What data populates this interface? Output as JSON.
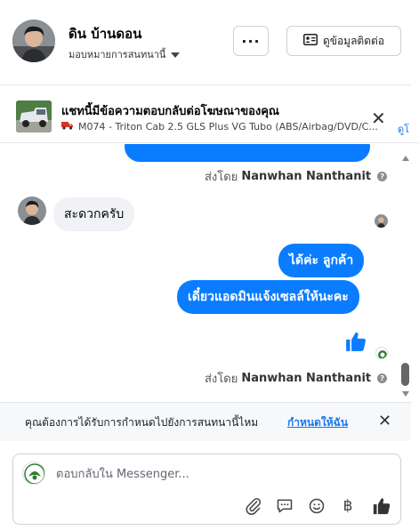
{
  "header": {
    "contact_name": "ดิน บ้านดอน",
    "assign_label": "มอบหมายการสนทนานี้",
    "more_label": "···",
    "contact_info_label": "ดูข้อมูลติดต่อ"
  },
  "ad_banner": {
    "title": "แชทนี้มีข้อความตอบกลับต่อโฆษณาของคุณ",
    "subtitle": "M074 - Triton Cab 2.5 GLS Plus VG Tubo (ABS/Airbag/DVD/C...",
    "link": "ดูโ"
  },
  "thread": {
    "sent_by_prefix": "ส่งโดย",
    "agent_name": "Nanwhan Nanthanit",
    "messages": [
      {
        "direction": "in",
        "text": "สะดวกครับ"
      },
      {
        "direction": "out",
        "text": "ได้ค่ะ  ลูกค้า"
      },
      {
        "direction": "out",
        "text": "เดี๋ยวแอดมินแจ้งเซลล์ให้นะคะ"
      }
    ]
  },
  "reminder": {
    "text": "คุณต้องการได้รับการกำหนดไปยังการสนทนานี้ไหม",
    "link": "กำหนดให้ฉัน"
  },
  "composer": {
    "placeholder": "ตอบกลับใน Messenger...",
    "baht_symbol": "฿"
  },
  "colors": {
    "accent": "#0a7cff",
    "link": "#1877f2",
    "incoming_bubble": "#f0f2f5"
  }
}
